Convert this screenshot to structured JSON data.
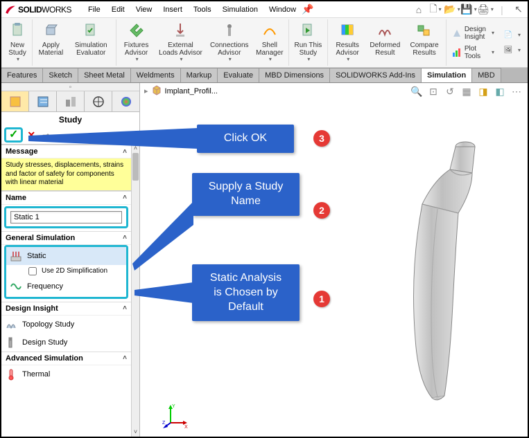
{
  "menubar": {
    "items": [
      "File",
      "Edit",
      "View",
      "Insert",
      "Tools",
      "Simulation",
      "Window"
    ],
    "logo_bold": "SOLID",
    "logo_rest": "WORKS"
  },
  "ribbon": {
    "new_study": "New Study",
    "apply_material": "Apply Material",
    "sim_eval": "Simulation Evaluator",
    "fixtures": "Fixtures Advisor",
    "ext_loads": "External Loads Advisor",
    "connections": "Connections Advisor",
    "shell_mgr": "Shell Manager",
    "run": "Run This Study",
    "results_adv": "Results Advisor",
    "deformed": "Deformed Result",
    "compare": "Compare Results",
    "design_insight": "Design Insight",
    "plot_tools": "Plot Tools"
  },
  "tabs": [
    "Features",
    "Sketch",
    "Sheet Metal",
    "Weldments",
    "Markup",
    "Evaluate",
    "MBD Dimensions",
    "SOLIDWORKS Add-Ins",
    "Simulation",
    "MBD"
  ],
  "doc_name": "Implant_Profil...",
  "panel": {
    "title": "Study",
    "message_header": "Message",
    "message_text": "Study stresses, displacements, strains and factor of safety  for components with linear material",
    "name_header": "Name",
    "name_value": "Static 1",
    "gensim_header": "General Simulation",
    "static": "Static",
    "use2d": "Use 2D Simplification",
    "frequency": "Frequency",
    "di_header": "Design Insight",
    "topology": "Topology Study",
    "design_study": "Design Study",
    "advsim_header": "Advanced Simulation",
    "thermal": "Thermal"
  },
  "callouts": {
    "c1": "Click OK",
    "c2": "Supply a Study Name",
    "c3_l1": "Static Analysis",
    "c3_l2": "is Chosen by",
    "c3_l3": "Default"
  },
  "badges": {
    "b1": "1",
    "b2": "2",
    "b3": "3"
  },
  "colors": {
    "callout_bg": "#2b62c9",
    "highlight_border": "#1fb6d1",
    "badge": "#e53935",
    "msg_bg": "#ffff99"
  }
}
